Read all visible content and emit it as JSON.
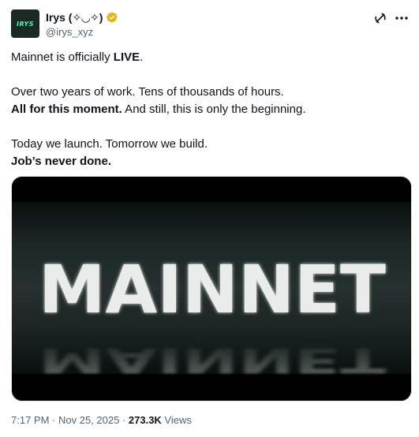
{
  "author": {
    "avatar_text": "IRYS",
    "display_name": "Irys (✧◡✧)",
    "handle": "@irys_xyz",
    "verified_color": "#e2b719"
  },
  "icons": {
    "grok": "grok-icon",
    "more": "more-icon"
  },
  "body": {
    "line1_prefix": "Mainnet is officially ",
    "line1_bold": "LIVE",
    "line1_suffix": ".",
    "line2": "Over two years of work. Tens of thousands of hours.",
    "line3_bold": "All for this moment.",
    "line3_rest": " And still, this is only the beginning.",
    "line4": "Today we launch. Tomorrow we build.",
    "line5_bold": "Job’s never done."
  },
  "media": {
    "headline": "MAINNET"
  },
  "meta": {
    "time": "7:17 PM",
    "sep1": " · ",
    "date": "Nov 25, 2025",
    "sep2": " · ",
    "views_count": "273.3K",
    "views_label": " Views"
  },
  "colors": {
    "text": "#0f1419",
    "secondary": "#536471",
    "brand_green": "#4ff2c0"
  }
}
